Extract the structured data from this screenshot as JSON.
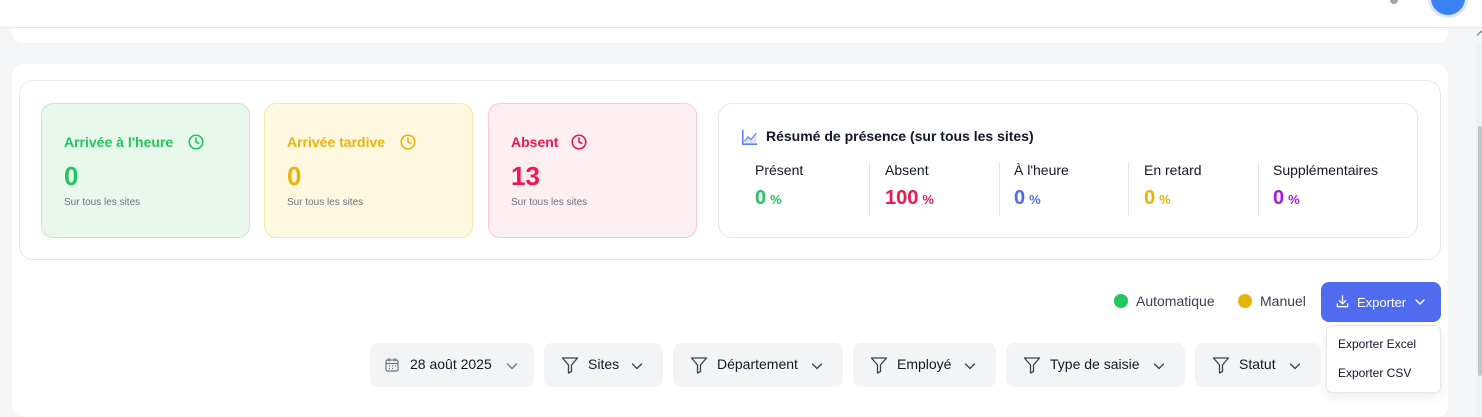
{
  "cards": [
    {
      "title": "Arrivée à l'heure",
      "value": "0",
      "subtitle": "Sur tous les sites",
      "icon": "clock-icon",
      "color": "#22c55e"
    },
    {
      "title": "Arrivée tardive",
      "value": "0",
      "subtitle": "Sur tous les sites",
      "icon": "clock-icon",
      "color": "#eab308"
    },
    {
      "title": "Absent",
      "value": "13",
      "subtitle": "Sur tous les sites",
      "icon": "clock-icon",
      "color": "#f0164f"
    }
  ],
  "summary": {
    "title": "Résumé de présence (sur tous les sites)",
    "icon": "line-chart-icon",
    "stats": [
      {
        "label": "Présent",
        "value": "0",
        "unit": "%",
        "color": "#22c55e"
      },
      {
        "label": "Absent",
        "value": "100",
        "unit": "%",
        "color": "#f0164f"
      },
      {
        "label": "À l'heure",
        "value": "0",
        "unit": "%",
        "color": "#4f6bf0"
      },
      {
        "label": "En retard",
        "value": "0",
        "unit": "%",
        "color": "#eab308"
      },
      {
        "label": "Supplémentaires",
        "value": "0",
        "unit": "%",
        "color": "#a21cde"
      }
    ]
  },
  "legend": [
    {
      "label": "Automatique",
      "color": "#22c55e"
    },
    {
      "label": "Manuel",
      "color": "#eab308"
    }
  ],
  "export": {
    "label": "Exporter",
    "color": "#4f6bf0",
    "menu": [
      "Exporter Excel",
      "Exporter CSV"
    ]
  },
  "filters": [
    {
      "label": "28 août 2025",
      "icon": "calendar-icon"
    },
    {
      "label": "Sites",
      "icon": "filter-icon"
    },
    {
      "label": "Département",
      "icon": "filter-icon"
    },
    {
      "label": "Employé",
      "icon": "filter-icon"
    },
    {
      "label": "Type de saisie",
      "icon": "filter-icon"
    },
    {
      "label": "Statut",
      "icon": "filter-icon"
    }
  ]
}
